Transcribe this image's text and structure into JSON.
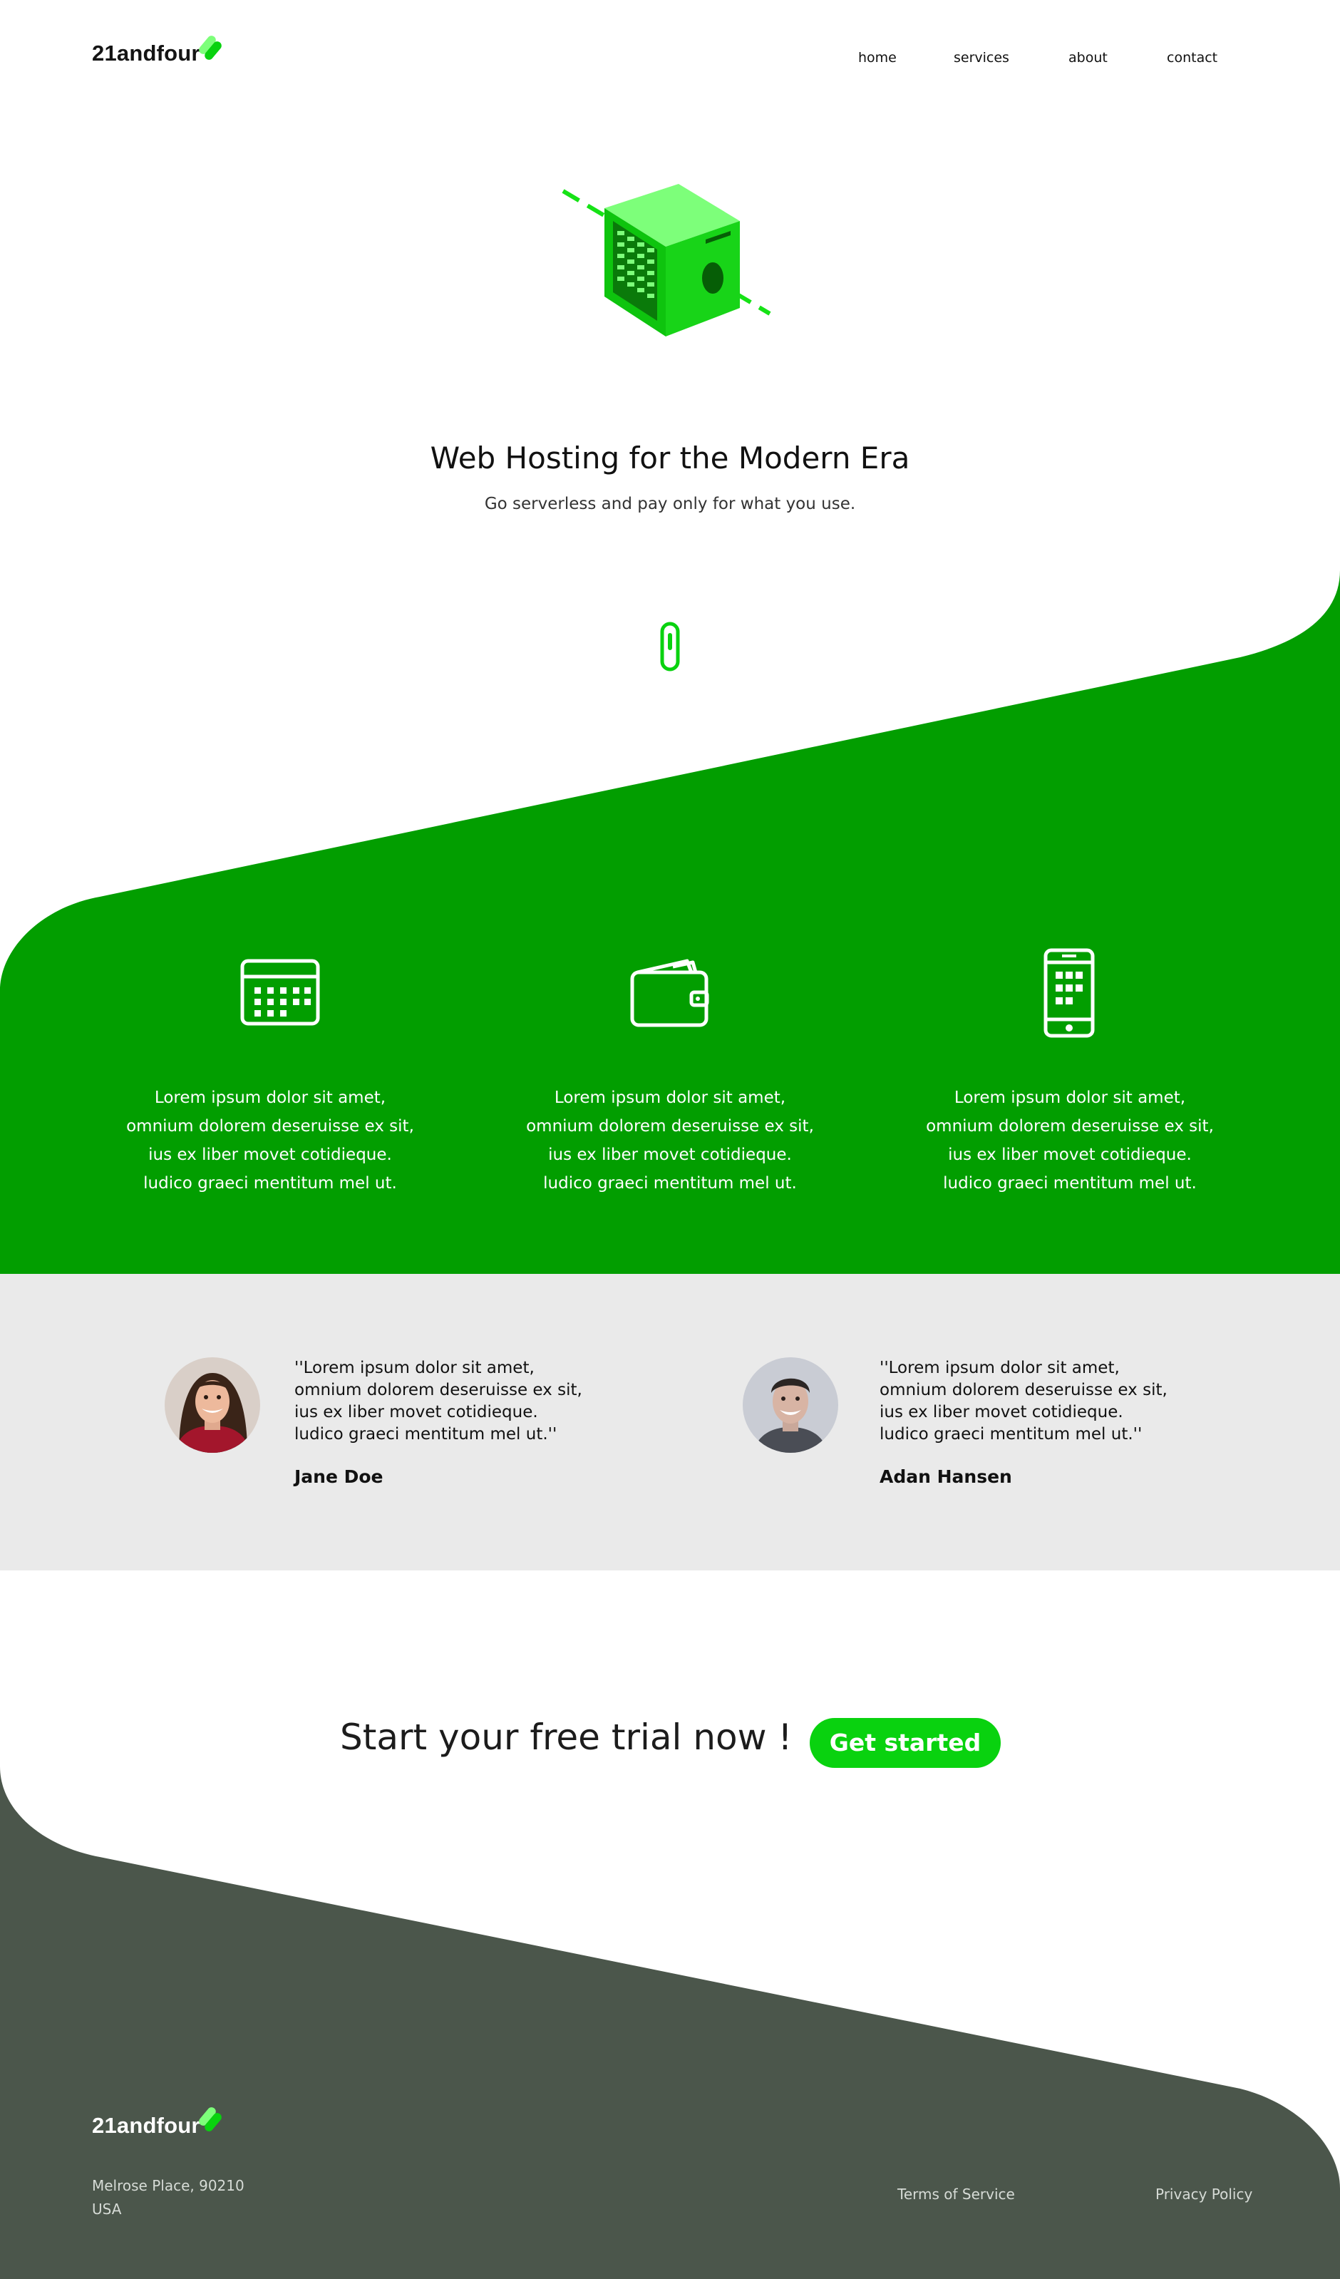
{
  "brand": {
    "name": "21andfour",
    "accent": "#09d20f",
    "accent_light": "#7dff7a"
  },
  "nav": {
    "items": [
      {
        "label": "home"
      },
      {
        "label": "services"
      },
      {
        "label": "about"
      },
      {
        "label": "contact"
      }
    ]
  },
  "hero": {
    "title": "Web Hosting for the Modern Era",
    "subtitle": "Go serverless and pay only for what you use.",
    "illustration_icon": "server-cube-icon",
    "scroll_icon": "scroll-indicator-icon"
  },
  "features": {
    "background": "#029e00",
    "items": [
      {
        "icon": "calendar-icon",
        "text": [
          "Lorem ipsum dolor sit amet,",
          "omnium dolorem deseruisse ex sit,",
          "ius ex liber movet cotidieque.",
          "ludico graeci mentitum mel ut."
        ]
      },
      {
        "icon": "wallet-icon",
        "text": [
          "Lorem ipsum dolor sit amet,",
          "omnium dolorem deseruisse ex sit,",
          "ius ex liber movet cotidieque.",
          "ludico graeci mentitum mel ut."
        ]
      },
      {
        "icon": "smartphone-icon",
        "text": [
          "Lorem ipsum dolor sit amet,",
          "omnium dolorem deseruisse ex sit,",
          "ius ex liber movet cotidieque.",
          "ludico graeci mentitum mel ut."
        ]
      }
    ]
  },
  "testimonials": {
    "background": "#eaeaea",
    "items": [
      {
        "quote": [
          "''Lorem ipsum dolor sit amet,",
          "omnium dolorem deseruisse ex sit,",
          "ius ex liber movet cotidieque.",
          "ludico graeci mentitum mel ut.''"
        ],
        "name": "Jane Doe"
      },
      {
        "quote": [
          "''Lorem ipsum dolor sit amet,",
          "omnium dolorem deseruisse ex sit,",
          "ius ex liber movet cotidieque.",
          "ludico graeci mentitum mel ut.''"
        ],
        "name": "Adan Hansen"
      }
    ]
  },
  "cta": {
    "text": "Start your free trial now !",
    "button_label": "Get started"
  },
  "footer": {
    "background": "#4b564b",
    "brand": "21andfour",
    "address": [
      "Melrose Place, 90210",
      "USA"
    ],
    "links": [
      {
        "label": "Terms of Service"
      },
      {
        "label": "Privacy Policy"
      }
    ]
  }
}
